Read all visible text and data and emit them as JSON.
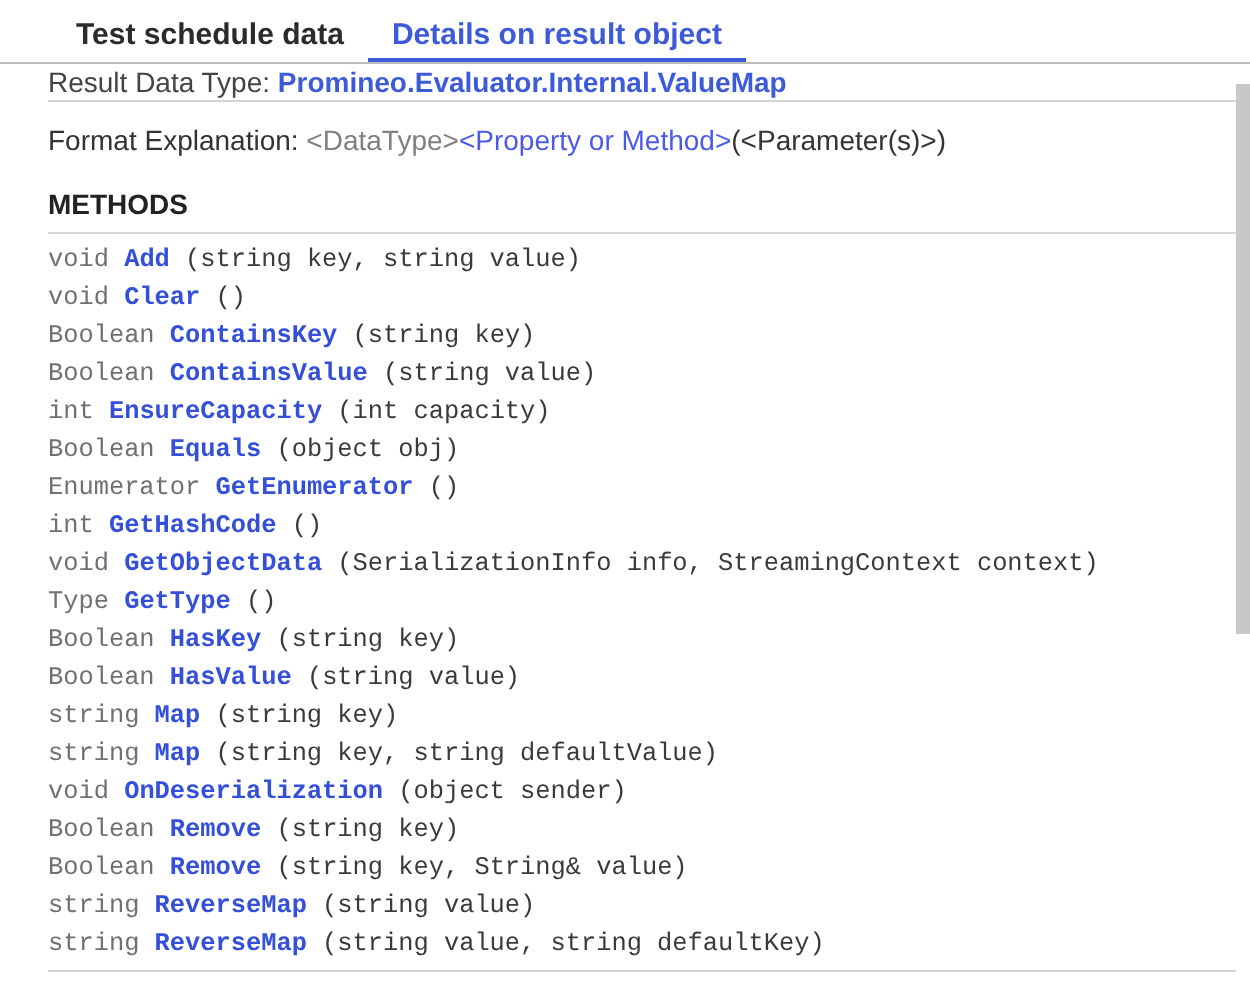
{
  "tabs": [
    {
      "label": "Test schedule data",
      "selected": false
    },
    {
      "label": "Details on result object",
      "selected": true
    }
  ],
  "result_type": {
    "label": "Result Data Type: ",
    "value": "Promineo.Evaluator.Internal.ValueMap"
  },
  "format_explanation": [
    {
      "kind": "label",
      "text": "Format Explanation: "
    },
    {
      "kind": "type",
      "text": "<DataType>"
    },
    {
      "kind": "member",
      "text": "<Property or Method>"
    },
    {
      "kind": "plain",
      "text": "(<Parameter(s)>)"
    }
  ],
  "methods_heading": "METHODS",
  "methods": [
    {
      "type": "void",
      "name": "Add",
      "params": "(string key, string value)"
    },
    {
      "type": "void",
      "name": "Clear",
      "params": "()"
    },
    {
      "type": "Boolean",
      "name": "ContainsKey",
      "params": "(string key)"
    },
    {
      "type": "Boolean",
      "name": "ContainsValue",
      "params": "(string value)"
    },
    {
      "type": "int",
      "name": "EnsureCapacity",
      "params": "(int capacity)"
    },
    {
      "type": "Boolean",
      "name": "Equals",
      "params": "(object obj)"
    },
    {
      "type": "Enumerator",
      "name": "GetEnumerator",
      "params": "()"
    },
    {
      "type": "int",
      "name": "GetHashCode",
      "params": "()"
    },
    {
      "type": "void",
      "name": "GetObjectData",
      "params": "(SerializationInfo info, StreamingContext context)"
    },
    {
      "type": "Type",
      "name": "GetType",
      "params": "()"
    },
    {
      "type": "Boolean",
      "name": "HasKey",
      "params": "(string key)"
    },
    {
      "type": "Boolean",
      "name": "HasValue",
      "params": "(string value)"
    },
    {
      "type": "string",
      "name": "Map",
      "params": "(string key)"
    },
    {
      "type": "string",
      "name": "Map",
      "params": "(string key, string defaultValue)"
    },
    {
      "type": "void",
      "name": "OnDeserialization",
      "params": "(object sender)"
    },
    {
      "type": "Boolean",
      "name": "Remove",
      "params": "(string key)"
    },
    {
      "type": "Boolean",
      "name": "Remove",
      "params": "(string key, String& value)"
    },
    {
      "type": "string",
      "name": "ReverseMap",
      "params": "(string value)"
    },
    {
      "type": "string",
      "name": "ReverseMap",
      "params": "(string value, string defaultKey)"
    }
  ]
}
